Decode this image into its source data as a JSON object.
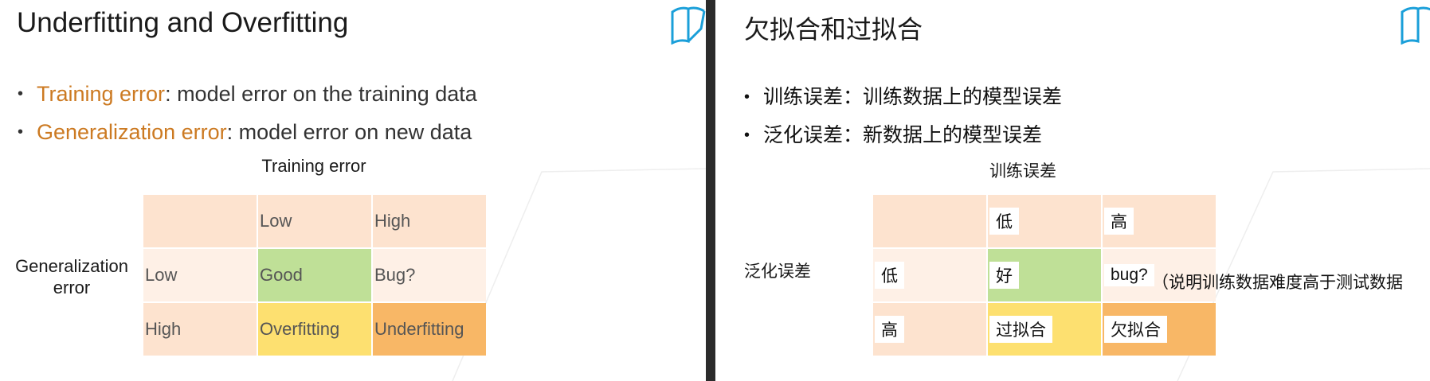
{
  "en": {
    "title": "Underfitting and Overfitting",
    "bullets": [
      {
        "term": "Training error",
        "text": ": model error on the training data"
      },
      {
        "term": "Generalization error",
        "text": ": model error on new data"
      }
    ],
    "col_axis": "Training error",
    "row_axis": "Generalization error",
    "col_headers": [
      "Low",
      "High"
    ],
    "rows": [
      {
        "label": "Low",
        "cells": [
          "Good",
          "Bug?"
        ]
      },
      {
        "label": "High",
        "cells": [
          "Overfitting",
          "Underfitting"
        ]
      }
    ]
  },
  "zh": {
    "title": "欠拟合和过拟合",
    "bullets": [
      {
        "term": "训练误差",
        "text": "：训练数据上的模型误差"
      },
      {
        "term": "泛化误差",
        "text": "：新数据上的模型误差"
      }
    ],
    "col_axis": "训练误差",
    "row_axis": "泛化误差",
    "col_headers": [
      "低",
      "高"
    ],
    "rows": [
      {
        "label": "低",
        "cells": [
          "好",
          "bug?"
        ]
      },
      {
        "label": "高",
        "cells": [
          "过拟合",
          "欠拟合"
        ]
      }
    ],
    "note": "（说明训练数据难度高于测试数据"
  },
  "colors": {
    "highlight": "#cc7a22",
    "header_cell": "#fde3cf",
    "row_cell": "#fef0e6",
    "good": "#bfe097",
    "overfitting": "#fde070",
    "underfitting": "#f8b766",
    "logo": "#1a9fd9"
  },
  "icons": {
    "logo": "book-logo-icon"
  }
}
